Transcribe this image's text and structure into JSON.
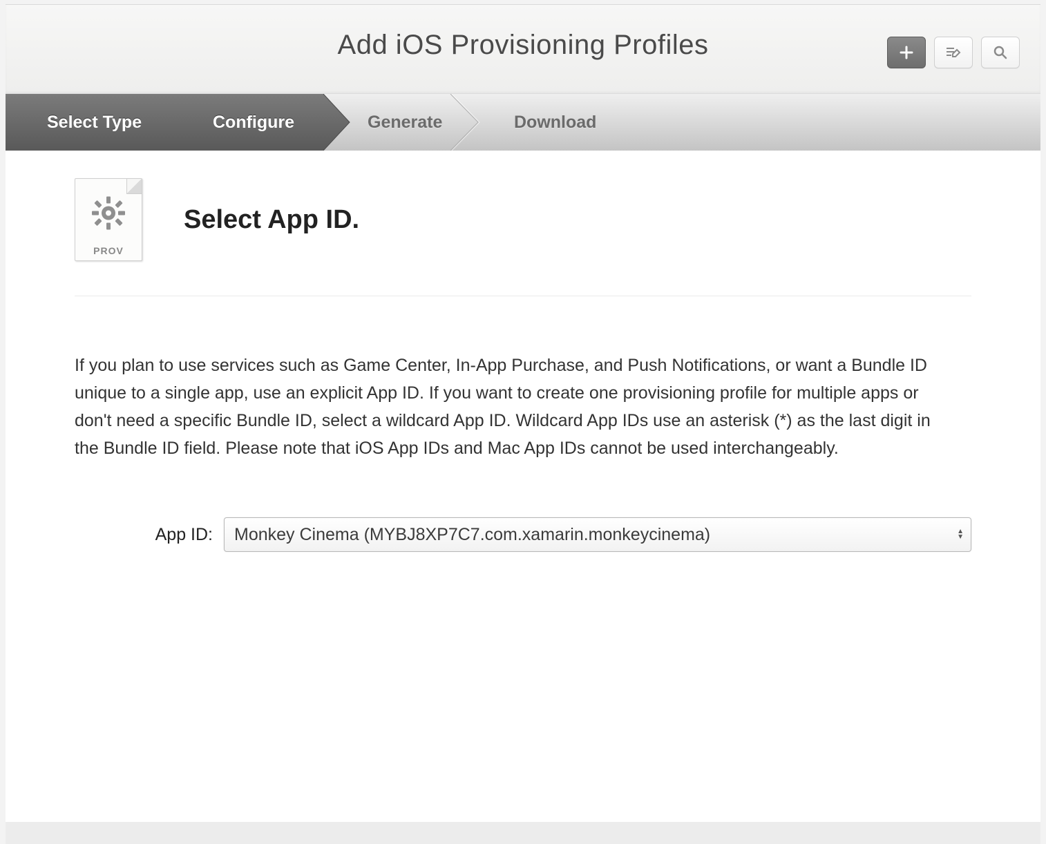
{
  "header": {
    "title": "Add iOS Provisioning Profiles"
  },
  "steps": [
    {
      "label": "Select Type",
      "state": "completed"
    },
    {
      "label": "Configure",
      "state": "active"
    },
    {
      "label": "Generate",
      "state": "upcoming"
    },
    {
      "label": "Download",
      "state": "upcoming"
    }
  ],
  "section": {
    "icon_label": "PROV",
    "title": "Select App ID."
  },
  "description": "If you plan to use services such as Game Center, In-App Purchase, and Push Notifications, or want a Bundle ID unique to a single app, use an explicit App ID. If you want to create one provisioning profile for multiple apps or don't need a specific Bundle ID, select a wildcard App ID. Wildcard App IDs use an asterisk (*) as the last digit in the Bundle ID field. Please note that iOS App IDs and Mac App IDs cannot be used interchangeably.",
  "form": {
    "app_id_label": "App ID:",
    "app_id_selected": "Monkey Cinema (MYBJ8XP7C7.com.xamarin.monkeycinema)"
  }
}
